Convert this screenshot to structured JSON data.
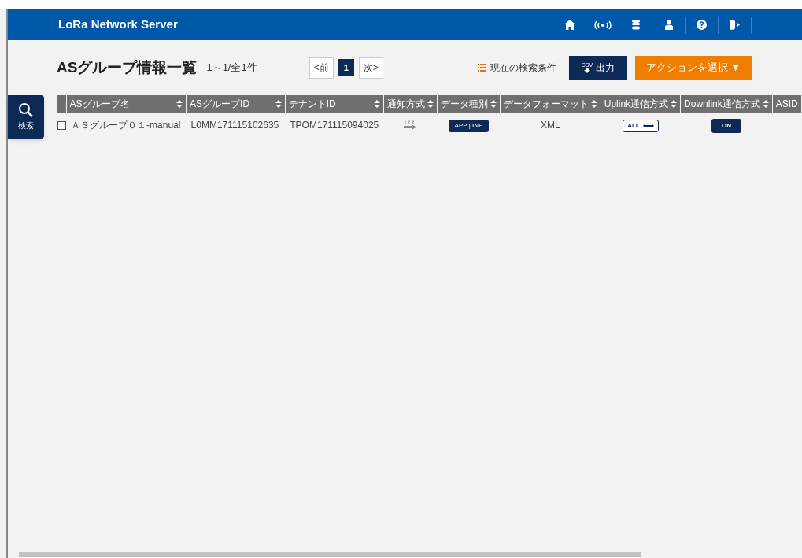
{
  "header": {
    "title": "LoRa Network Server"
  },
  "page": {
    "title": "ASグループ情報一覧",
    "count": "1～1/全1件"
  },
  "pagination": {
    "prev": "<前",
    "pages": [
      {
        "label": "1",
        "selected": true
      }
    ],
    "next": "次>"
  },
  "search_conditions": "現在の検索条件",
  "csv_button": {
    "badge": "CSV",
    "label": "出力"
  },
  "action_button": "アクションを選択 ▼",
  "search_button": "検索",
  "table": {
    "columns": [
      "ASグループ名",
      "ASグループID",
      "テナントID",
      "通知方式",
      "データ種別",
      "データフォーマット",
      "Uplink通信方式",
      "Downlink通信方式",
      "ASID"
    ],
    "rows": [
      {
        "checked": false,
        "name": "ＡＳグループ０１-manual",
        "group_id": "L0MM171115102635",
        "tenant_id": "TPOM171115094025",
        "data_type": "APP | INF",
        "format": "XML",
        "uplink": "ALL",
        "downlink": "ON"
      }
    ]
  }
}
